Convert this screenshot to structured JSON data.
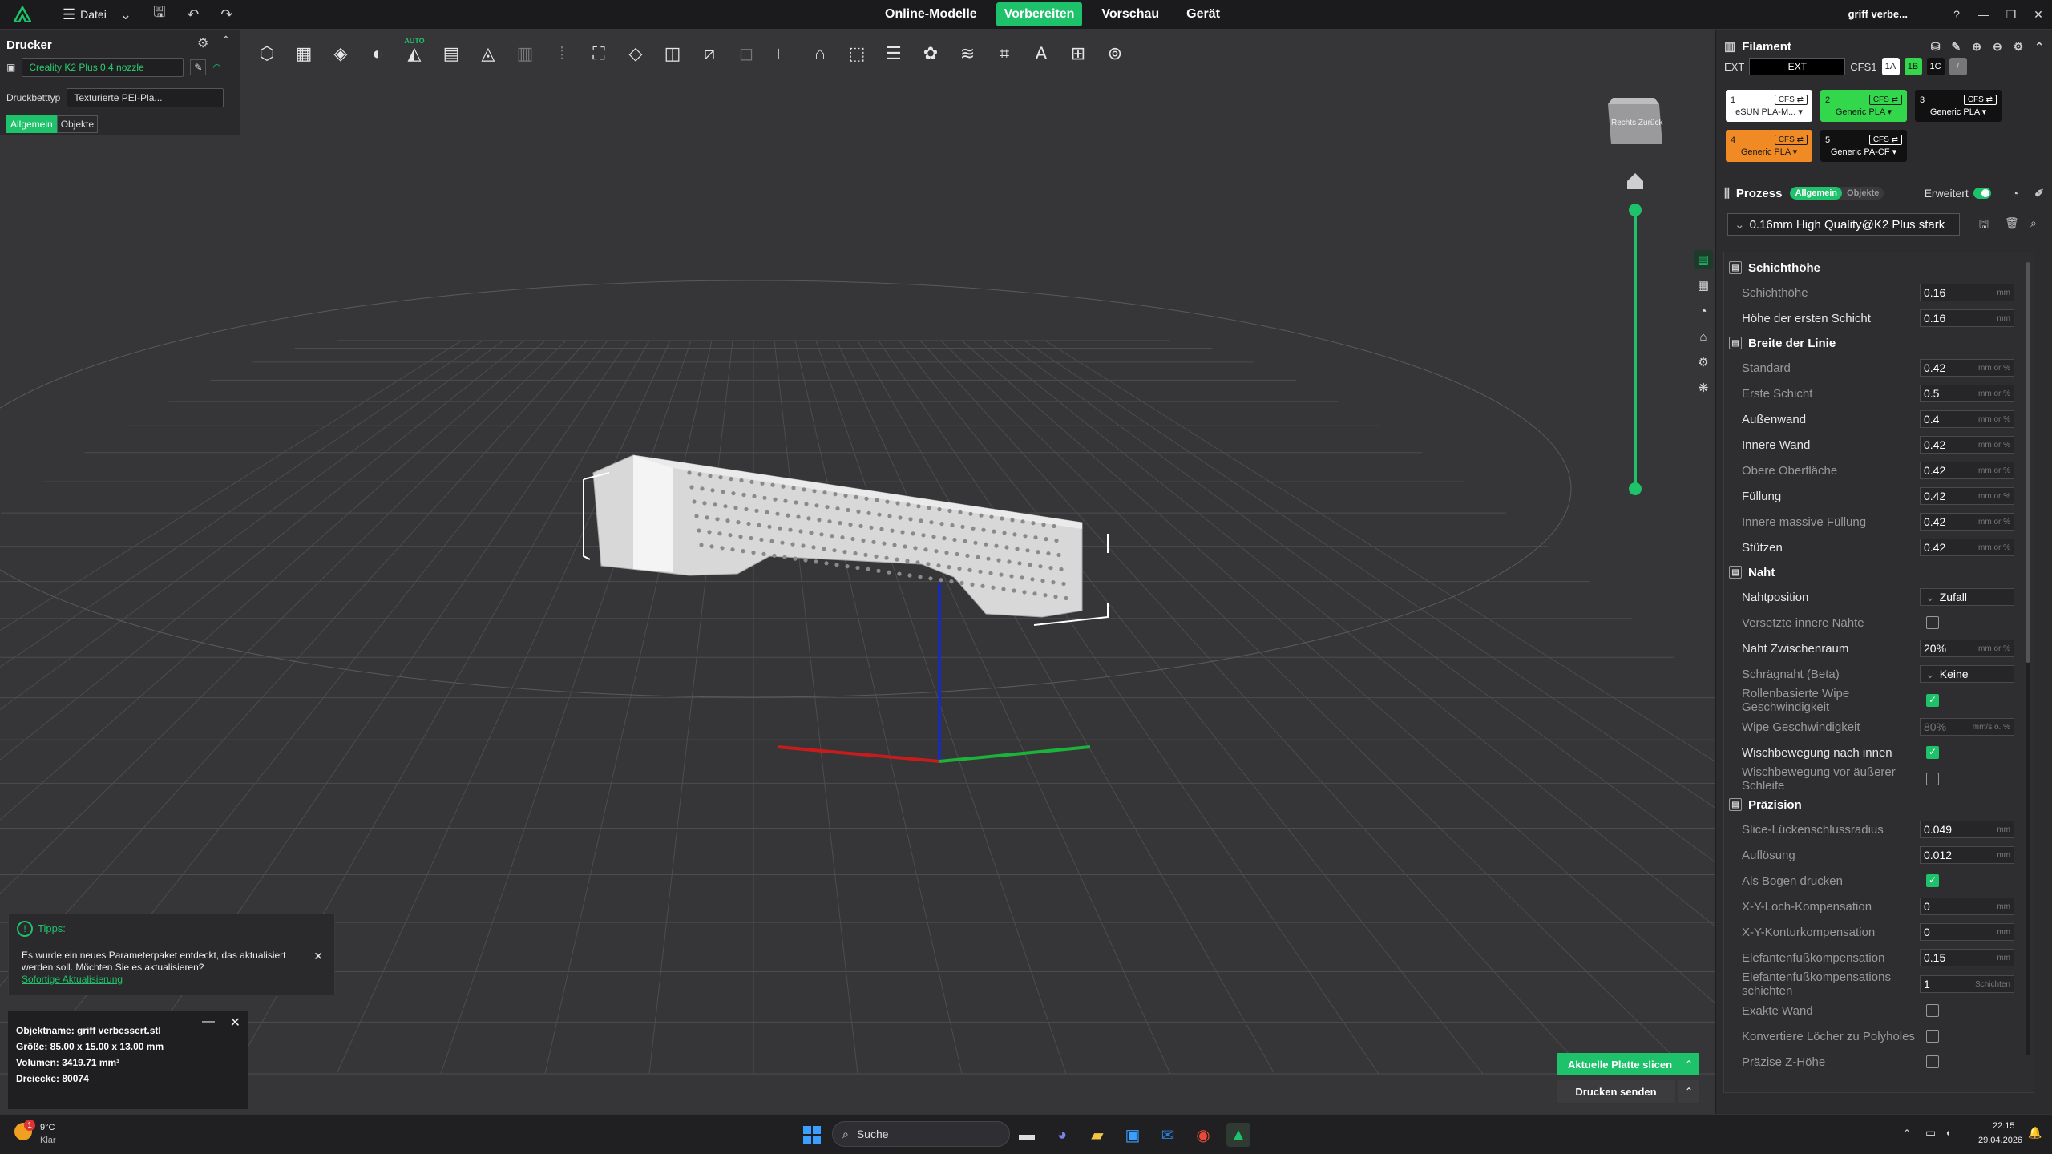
{
  "titlebar": {
    "menu_label": "Datei",
    "tabs": [
      "Online-Modelle",
      "Vorbereiten",
      "Vorschau",
      "Gerät"
    ],
    "active_tab": 1,
    "user": "griff verbe..."
  },
  "printer": {
    "title": "Drucker",
    "printer_name": "Creality K2 Plus 0.4 nozzle",
    "bed_label": "Druckbetttyp",
    "bed_value": "Texturierte PEI-Pla...",
    "seg_general": "Allgemein",
    "seg_objects": "Objekte"
  },
  "toolbar": {
    "auto_label": "AUTO"
  },
  "viewcube": {
    "label": "Rechts Zurück"
  },
  "filament": {
    "title": "Filament",
    "ext_label": "EXT",
    "ext_value": "EXT",
    "cfs_label": "CFS1",
    "badges": [
      "1A",
      "1B",
      "1C",
      "/"
    ],
    "slots": [
      {
        "num": "1",
        "tag": "CFS ⇄",
        "name": "eSUN PLA-M... ▾",
        "bg": "#ffffff",
        "fg": "#222222"
      },
      {
        "num": "2",
        "tag": "CFS ⇄",
        "name": "Generic PLA ▾",
        "bg": "#32d74b",
        "fg": "#1a1a1a"
      },
      {
        "num": "3",
        "tag": "CFS ⇄",
        "name": "Generic PLA ▾",
        "bg": "#111111",
        "fg": "#ffffff"
      },
      {
        "num": "4",
        "tag": "CFS ⇄",
        "name": "Generic PLA ▾",
        "bg": "#f08a24",
        "fg": "#1a1a1a"
      },
      {
        "num": "5",
        "tag": "CFS ⇄",
        "name": "Generic PA-CF ▾",
        "bg": "#111111",
        "fg": "#ffffff"
      }
    ]
  },
  "process": {
    "title": "Prozess",
    "pill_general": "Allgemein",
    "pill_objects": "Objekte",
    "advanced": "Erweitert",
    "preset": "0.16mm High Quality@K2 Plus stark"
  },
  "settings": [
    {
      "kind": "section",
      "label": "Schichthöhe"
    },
    {
      "kind": "value",
      "label": "Schichthöhe",
      "value": "0.16",
      "unit": "mm"
    },
    {
      "kind": "value",
      "label": "Höhe der ersten Schicht",
      "value": "0.16",
      "unit": "mm",
      "bright": true
    },
    {
      "kind": "section",
      "label": "Breite der Linie"
    },
    {
      "kind": "value",
      "label": "Standard",
      "value": "0.42",
      "unit": "mm or %"
    },
    {
      "kind": "value",
      "label": "Erste Schicht",
      "value": "0.5",
      "unit": "mm or %"
    },
    {
      "kind": "value",
      "label": "Außenwand",
      "value": "0.4",
      "unit": "mm or %",
      "bright": true
    },
    {
      "kind": "value",
      "label": "Innere Wand",
      "value": "0.42",
      "unit": "mm or %",
      "bright": true
    },
    {
      "kind": "value",
      "label": "Obere Oberfläche",
      "value": "0.42",
      "unit": "mm or %"
    },
    {
      "kind": "value",
      "label": "Füllung",
      "value": "0.42",
      "unit": "mm or %",
      "bright": true
    },
    {
      "kind": "value",
      "label": "Innere massive Füllung",
      "value": "0.42",
      "unit": "mm or %"
    },
    {
      "kind": "value",
      "label": "Stützen",
      "value": "0.42",
      "unit": "mm or %",
      "bright": true
    },
    {
      "kind": "section",
      "label": "Naht"
    },
    {
      "kind": "dropdown",
      "label": "Nahtposition",
      "value": "Zufall",
      "bright": true
    },
    {
      "kind": "check",
      "label": "Versetzte innere Nähte",
      "checked": false
    },
    {
      "kind": "value",
      "label": "Naht Zwischenraum",
      "value": "20%",
      "unit": "mm or %",
      "bright": true
    },
    {
      "kind": "dropdown",
      "label": "Schrägnaht (Beta)",
      "value": "Keine"
    },
    {
      "kind": "check",
      "label": "Rollenbasierte Wipe Geschwindigkeit",
      "checked": true
    },
    {
      "kind": "value",
      "label": "Wipe Geschwindigkeit",
      "value": "80%",
      "unit": "mm/s o. %",
      "dim": true
    },
    {
      "kind": "check",
      "label": "Wischbewegung nach innen",
      "checked": true,
      "bright": true
    },
    {
      "kind": "check",
      "label": "Wischbewegung vor äußerer Schleife",
      "checked": false
    },
    {
      "kind": "section",
      "label": "Präzision"
    },
    {
      "kind": "value",
      "label": "Slice-Lückenschlussradius",
      "value": "0.049",
      "unit": "mm"
    },
    {
      "kind": "value",
      "label": "Auflösung",
      "value": "0.012",
      "unit": "mm"
    },
    {
      "kind": "check",
      "label": "Als Bogen drucken",
      "checked": true
    },
    {
      "kind": "value",
      "label": "X-Y-Loch-Kompensation",
      "value": "0",
      "unit": "mm"
    },
    {
      "kind": "value",
      "label": "X-Y-Konturkompensation",
      "value": "0",
      "unit": "mm"
    },
    {
      "kind": "value",
      "label": "Elefantenfußkompensation",
      "value": "0.15",
      "unit": "mm"
    },
    {
      "kind": "value",
      "label": "Elefantenfußkompensations schichten",
      "value": "1",
      "unit": "Schichten"
    },
    {
      "kind": "check",
      "label": "Exakte Wand",
      "checked": false
    },
    {
      "kind": "check",
      "label": "Konvertiere Löcher zu Polyholes",
      "checked": false
    },
    {
      "kind": "check",
      "label": "Präzise Z-Höhe",
      "checked": false
    }
  ],
  "tips": {
    "title": "Tipps:",
    "message": "Es wurde ein neues Parameterpaket entdeckt, das aktualisiert werden soll. Möchten Sie es aktualisieren?",
    "link": "Sofortige Aktualisierung"
  },
  "object_info": {
    "name": "Objektname: griff verbessert.stl",
    "size": "Größe: 85.00 x 15.00 x 13.00 mm",
    "volume": "Volumen: 3419.71 mm³",
    "triangles": "Dreiecke: 80074"
  },
  "actions": {
    "slice": "Aktuelle Platte slicen",
    "send": "Drucken senden"
  },
  "taskbar": {
    "weather_temp": "9°C",
    "weather_text": "Klar",
    "search": "Suche",
    "time": "22:15",
    "date": "29.04.2026"
  },
  "colors": {
    "accent": "#1ec26a",
    "bg": "#363638"
  }
}
